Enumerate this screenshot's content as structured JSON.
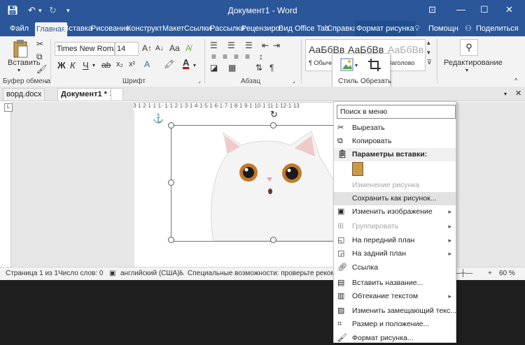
{
  "titlebar": {
    "title": "Документ1 - Word",
    "minimize": "—",
    "maximize": "☐",
    "close": "✕"
  },
  "tabs": [
    "Файл",
    "Главная",
    "Вставка",
    "Рисование",
    "Конструкт",
    "Макет",
    "Ссылки",
    "Рассылки",
    "Рецензиро",
    "Вид",
    "Office Tab",
    "Справка",
    "Формат рисунка"
  ],
  "help": "Помощн",
  "share": "Поделиться",
  "ribbon": {
    "paste_label": "Вставить",
    "clipboard_label": "Буфер обмена",
    "font_name": "Times New Roma",
    "font_size": "14",
    "bold": "Ж",
    "italic": "К",
    "underline": "Ч",
    "font_group": "Шрифт",
    "paragraph_group": "Абзац",
    "styles": [
      "АаБбВв",
      "АаБбВв",
      "АаБбВв"
    ],
    "style_normal": "¶ Обычн",
    "style_heading": "Заголово",
    "editing": "Редактирование"
  },
  "popup": {
    "style": "Стиль",
    "crop": "Обрезать"
  },
  "doctabs": {
    "tab1": "ворд.docx",
    "tab2": "Документ1 *"
  },
  "ruler": "3·1·2·1·1·1··1·1·2·1·3·1·4·1·5·1·6·1·7·1·8·1·9·1·10·1·11·1·12·1·13",
  "status": {
    "page": "Страница 1 из 1",
    "words": "Число слов: 0",
    "lang": "английский (США)",
    "access": "Специальные возможности: проверьте рекомендации",
    "zoom": "60 %"
  },
  "context_menu": {
    "search": "Поиск в меню",
    "items": [
      {
        "label": "Вырезать",
        "icon": "scissors-icon",
        "state": "normal"
      },
      {
        "label": "Копировать",
        "icon": "copy-icon",
        "state": "normal"
      },
      {
        "label": "Параметры вставки:",
        "icon": "clipboard-icon",
        "state": "header"
      },
      {
        "label": "",
        "icon": "paste-option-icon",
        "state": "normal"
      },
      {
        "label": "Изменение рисунка",
        "icon": "",
        "state": "disabled"
      },
      {
        "label": "Сохранить как рисунок...",
        "icon": "",
        "state": "highlight"
      },
      {
        "label": "Изменить изображение",
        "icon": "change-picture-icon",
        "state": "submenu"
      },
      {
        "label": "Группировать",
        "icon": "group-icon",
        "state": "disabled-submenu"
      },
      {
        "label": "На передний план",
        "icon": "bring-forward-icon",
        "state": "submenu"
      },
      {
        "label": "На задний план",
        "icon": "send-backward-icon",
        "state": "submenu"
      },
      {
        "label": "Ссылка",
        "icon": "link-icon",
        "state": "normal"
      },
      {
        "label": "Вставить название...",
        "icon": "caption-icon",
        "state": "normal"
      },
      {
        "label": "Обтекание текстом",
        "icon": "wrap-text-icon",
        "state": "submenu"
      },
      {
        "label": "Изменить замещающий текс...",
        "icon": "alt-text-icon",
        "state": "normal"
      },
      {
        "label": "Размер и положение...",
        "icon": "size-position-icon",
        "state": "normal"
      },
      {
        "label": "Формат рисунка...",
        "icon": "format-picture-icon",
        "state": "normal"
      }
    ]
  },
  "colors": {
    "accent": "#2b579a",
    "font_color": "#d00000",
    "highlight": "#e2e2e2"
  }
}
